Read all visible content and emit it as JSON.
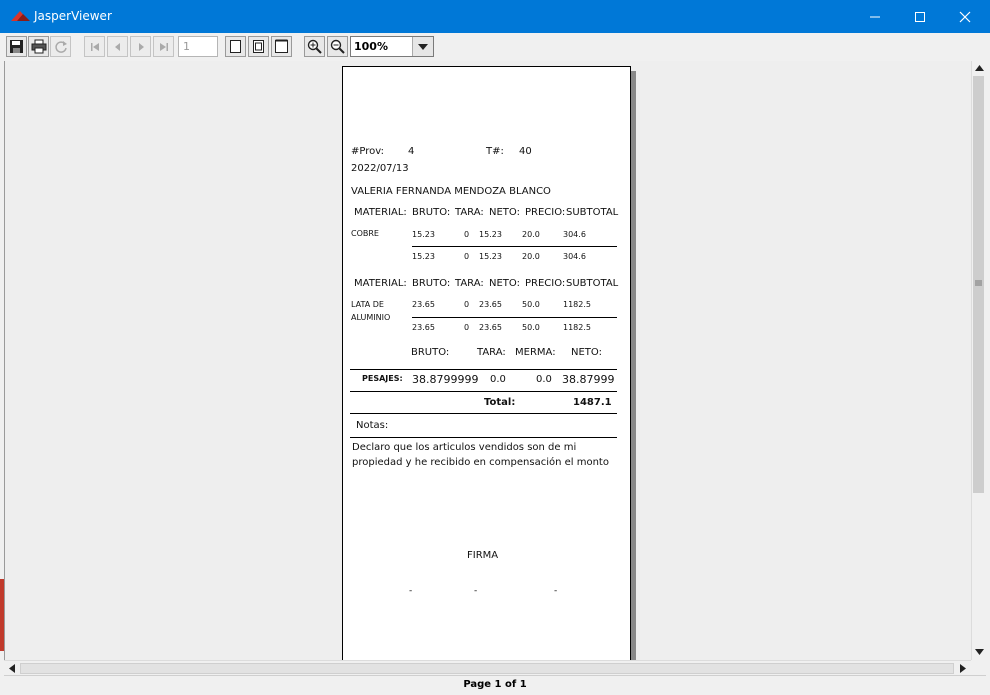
{
  "window": {
    "title": "JasperViewer",
    "controls": {
      "minimize": "minimize-icon",
      "maximize": "maximize-icon",
      "close": "close-icon"
    }
  },
  "toolbar": {
    "page_input_value": "1",
    "zoom_value": "100%",
    "icons": [
      "save-icon",
      "print-icon",
      "reload-icon",
      "first-page-icon",
      "previous-page-icon",
      "next-page-icon",
      "last-page-icon",
      "actual-size-icon",
      "fit-page-icon",
      "fit-width-icon",
      "zoom-in-icon",
      "zoom-out-icon"
    ]
  },
  "report": {
    "prov_label": "#Prov:",
    "prov_value": "4",
    "ticket_label": "T#:",
    "ticket_value": "40",
    "date": "2022/07/13",
    "customer": "VALERIA FERNANDA MENDOZA BLANCO",
    "headers": {
      "material": "MATERIAL:",
      "bruto": "BRUTO:",
      "tara": "TARA:",
      "neto": "NETO:",
      "precio": "PRECIO:",
      "subtotal": "SUBTOTAL"
    },
    "items": [
      {
        "material": "COBRE",
        "material_line2": "",
        "rows": [
          {
            "bruto": "15.23",
            "tara": "0",
            "neto": "15.23",
            "precio": "20.0",
            "subtotal": "304.6"
          },
          {
            "bruto": "15.23",
            "tara": "0",
            "neto": "15.23",
            "precio": "20.0",
            "subtotal": "304.6"
          }
        ]
      },
      {
        "material": "LATA DE",
        "material_line2": "ALUMINIO",
        "rows": [
          {
            "bruto": "23.65",
            "tara": "0",
            "neto": "23.65",
            "precio": "50.0",
            "subtotal": "1182.5"
          },
          {
            "bruto": "23.65",
            "tara": "0",
            "neto": "23.65",
            "precio": "50.0",
            "subtotal": "1182.5"
          }
        ]
      }
    ],
    "summary_headers": {
      "bruto": "BRUTO:",
      "tara": "TARA:",
      "merma": "MERMA:",
      "neto": "NETO:"
    },
    "pesajes": {
      "label": "PESAJES:",
      "bruto": "38.8799999",
      "tara": "0.0",
      "merma": "0.0",
      "neto": "38.87999"
    },
    "total_label": "Total:",
    "total_value": "1487.1",
    "notas_label": "Notas:",
    "declaration_line1": "Declaro que los articulos vendidos son de mi",
    "declaration_line2": "propiedad  y he recibido en compensación el monto",
    "firma_label": "FIRMA",
    "dash": "-"
  },
  "status": {
    "page_text": "Page 1 of 1"
  }
}
